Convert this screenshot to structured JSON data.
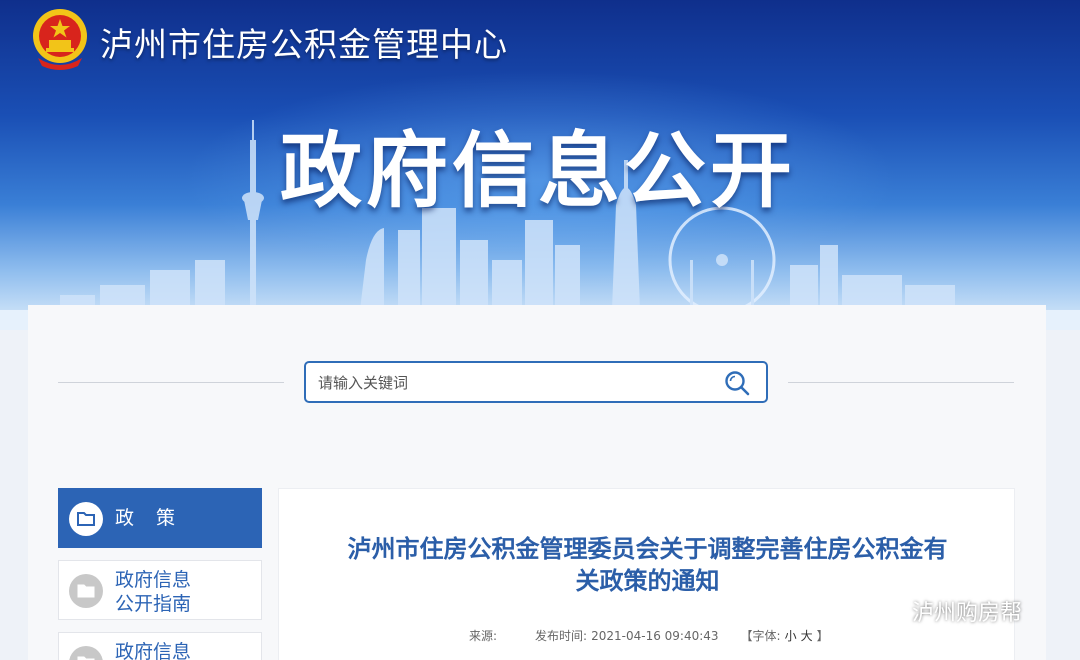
{
  "header": {
    "site_title": "泸州市住房公积金管理中心",
    "banner_heading": "政府信息公开",
    "emblem_icon": "national-emblem-icon"
  },
  "search": {
    "placeholder": "请输入关键词",
    "value": "",
    "icon": "search-icon",
    "border_color": "#2f6db8"
  },
  "sidebar": {
    "items": [
      {
        "label": "政策",
        "active": true,
        "icon": "folder-icon"
      },
      {
        "label_line1": "政府信息",
        "label_line2": "公开指南",
        "active": false,
        "icon": "folder-icon"
      },
      {
        "label_line1": "政府信息",
        "active": false,
        "icon": "folder-icon"
      }
    ],
    "active_color": "#2c64b5"
  },
  "article": {
    "title_line1": "泸州市住房公积金管理委员会关于调整完善住房公积金有",
    "title_line2": "关政策的通知",
    "source_label": "来源:",
    "date_label": "发布时间:",
    "date_value": "2021-04-16 09:40:43",
    "font_label": "【字体:",
    "font_small": "小",
    "font_large": "大",
    "font_close": "】",
    "title_color": "#2b5ea8"
  },
  "watermark": {
    "text": "泸州购房帮",
    "icon": "wechat-icon"
  }
}
